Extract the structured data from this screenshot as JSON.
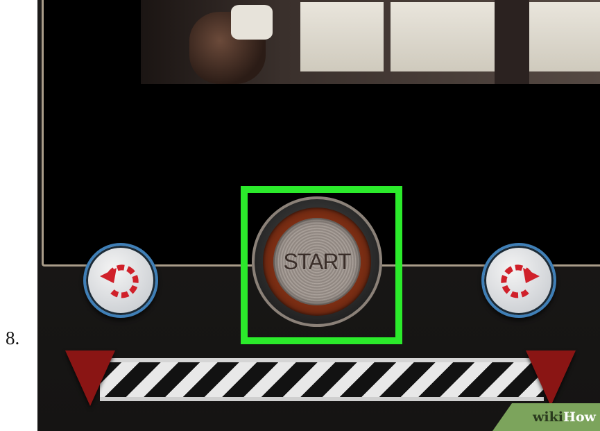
{
  "step": {
    "number": "8."
  },
  "buttons": {
    "start_label": "START",
    "rotate_left_icon": "rotate-counterclockwise-icon",
    "rotate_right_icon": "rotate-clockwise-icon"
  },
  "watermark": {
    "wiki": "wiki",
    "how": "How"
  },
  "colors": {
    "highlight": "#2bea2b",
    "rotate_arrow": "#d0202a",
    "rotate_border": "#3f7fb7",
    "handle": "#8a1514",
    "frame": "#a99c89",
    "watermark_bg": "#7ca45c"
  }
}
